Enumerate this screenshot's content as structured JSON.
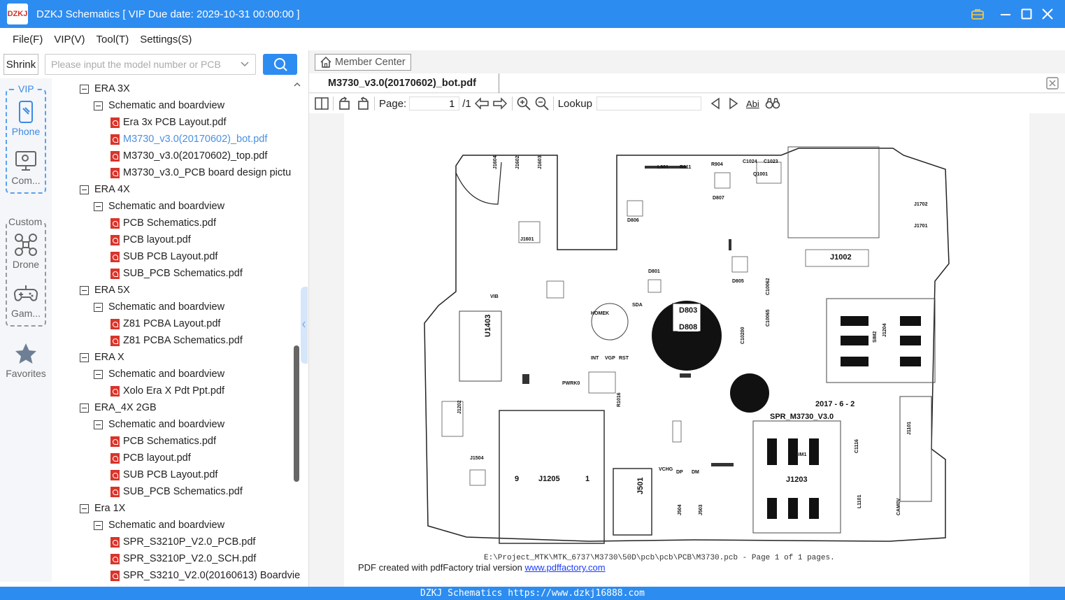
{
  "window": {
    "title": "DZKJ Schematics [ VIP Due date: 2029-10-31 00:00:00 ]",
    "logo_text": "DZKJ"
  },
  "menu": [
    "File(F)",
    "VIP(V)",
    "Tool(T)",
    "Settings(S)"
  ],
  "search": {
    "shrink_label": "Shrink",
    "placeholder": "Please input the model number or PCB"
  },
  "sidenav": {
    "vip_label": "VIP",
    "custom_label": "Custom",
    "items": [
      "Phone",
      "Com...",
      "Drone",
      "Gam...",
      "Favorites"
    ]
  },
  "tree": [
    {
      "level": 0,
      "label": "ERA 3X"
    },
    {
      "level": 1,
      "label": "Schematic and boardview"
    },
    {
      "level": 2,
      "label": "Era 3x PCB Layout.pdf"
    },
    {
      "level": 2,
      "label": "M3730_v3.0(20170602)_bot.pdf",
      "selected": true
    },
    {
      "level": 2,
      "label": "M3730_v3.0(20170602)_top.pdf"
    },
    {
      "level": 2,
      "label": "M3730_v3.0_PCB board design pictu"
    },
    {
      "level": 0,
      "label": "ERA 4X"
    },
    {
      "level": 1,
      "label": "Schematic and boardview"
    },
    {
      "level": 2,
      "label": "PCB Schematics.pdf"
    },
    {
      "level": 2,
      "label": "PCB layout.pdf"
    },
    {
      "level": 2,
      "label": "SUB PCB Layout.pdf"
    },
    {
      "level": 2,
      "label": "SUB_PCB Schematics.pdf"
    },
    {
      "level": 0,
      "label": "ERA 5X"
    },
    {
      "level": 1,
      "label": "Schematic and boardview"
    },
    {
      "level": 2,
      "label": "Z81 PCBA Layout.pdf"
    },
    {
      "level": 2,
      "label": "Z81 PCBA Schematics.pdf"
    },
    {
      "level": 0,
      "label": "ERA X"
    },
    {
      "level": 1,
      "label": "Schematic and boardview"
    },
    {
      "level": 2,
      "label": "Xolo Era X Pdt Ppt.pdf"
    },
    {
      "level": 0,
      "label": "ERA_4X 2GB"
    },
    {
      "level": 1,
      "label": "Schematic and boardview"
    },
    {
      "level": 2,
      "label": "PCB Schematics.pdf"
    },
    {
      "level": 2,
      "label": "PCB layout.pdf"
    },
    {
      "level": 2,
      "label": "SUB PCB Layout.pdf"
    },
    {
      "level": 2,
      "label": "SUB_PCB Schematics.pdf"
    },
    {
      "level": 0,
      "label": "Era 1X"
    },
    {
      "level": 1,
      "label": "Schematic and boardview"
    },
    {
      "level": 2,
      "label": "SPR_S3210P_V2.0_PCB.pdf"
    },
    {
      "level": 2,
      "label": "SPR_S3210P_V2.0_SCH.pdf"
    },
    {
      "level": 2,
      "label": "SPR_S3210_V2.0(20160613) Boardvie"
    }
  ],
  "viewer": {
    "member_center": "Member Center",
    "tab_label": "M3730_v3.0(20170602)_bot.pdf",
    "page_label": "Page:",
    "page_current": "1",
    "page_total": "/1",
    "lookup_label": "Lookup",
    "abi_label": "Abi",
    "document": {
      "board_labels": [
        "J1604",
        "J1602",
        "J1603",
        "L901",
        "R911",
        "R904",
        "C1024",
        "C1023",
        "Q1001",
        "J1702",
        "J1701",
        "D806",
        "D807",
        "J1601",
        "J1002",
        "D805",
        "D801",
        "U1403",
        "D803",
        "D808",
        "J1204",
        "SIM2",
        "J1202",
        "J1504",
        "J1205",
        "9",
        "1",
        "J501",
        "VCHG",
        "DP",
        "DM",
        "J504",
        "J503",
        "J1203",
        "SIM1",
        "J1101",
        "2017 - 6 - 2",
        "SPR_M3730_V3.0",
        "HOMEK",
        "PWRK0",
        "INT",
        "VGP",
        "RST",
        "SDA",
        "VIB",
        "C10062",
        "C10065",
        "C10200",
        "R1016",
        "C1116",
        "L1101",
        "CAM0V"
      ],
      "path_text": "E:\\Project_MTK\\MTK_6737\\M3730\\50D\\pcb\\pcb\\PCB\\M3730.pcb - Page 1 of 1 pages.",
      "pdf_note": "PDF created with pdfFactory trial version",
      "pdf_link": "www.pdffactory.com"
    }
  },
  "footer": "DZKJ Schematics https://www.dzkj16888.com",
  "colors": {
    "accent": "#2d8cf0",
    "pdf_icon": "#d9342b",
    "selected": "#4a90e2"
  }
}
